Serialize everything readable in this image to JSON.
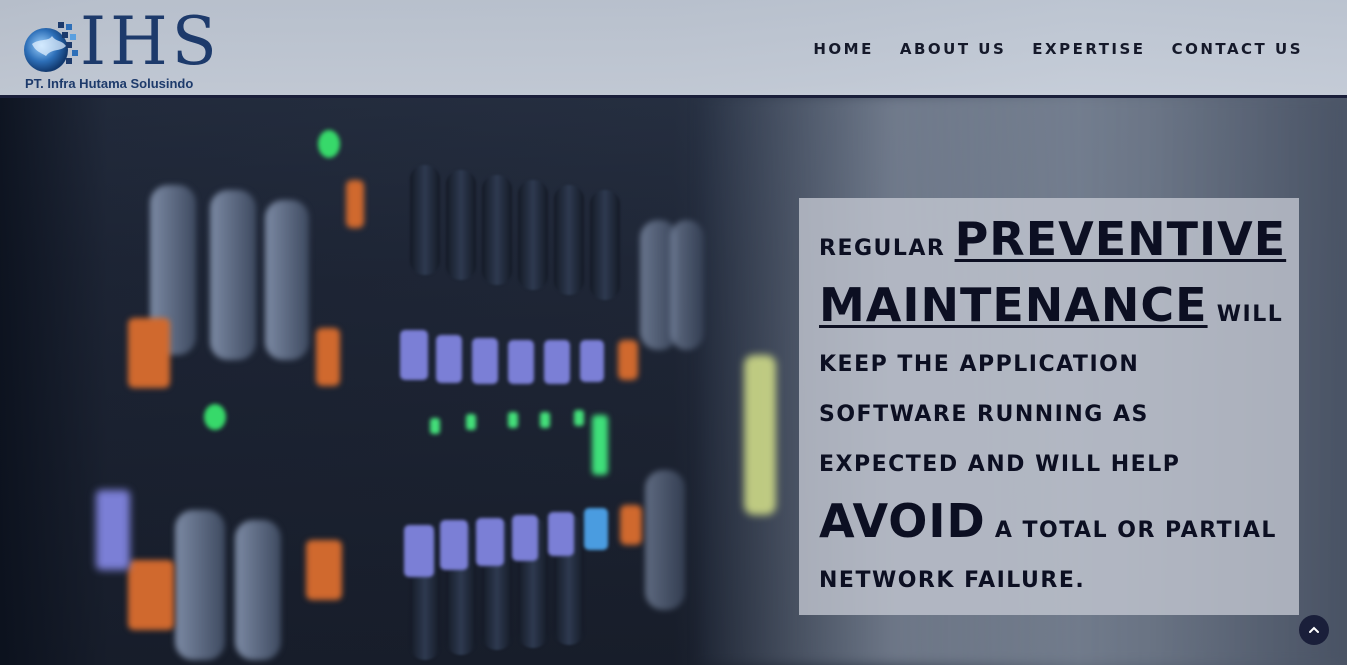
{
  "header": {
    "logo_letters": "IHS",
    "logo_tagline": "PT. Infra Hutama Solusindo",
    "logo_icon": "globe-icon"
  },
  "nav": {
    "items": [
      {
        "label": "HOME"
      },
      {
        "label": "ABOUT US"
      },
      {
        "label": "EXPERTISE"
      },
      {
        "label": "CONTACT US"
      }
    ]
  },
  "hero": {
    "line1_prefix": "REGULAR",
    "line1_emphasis": "PREVENTIVE",
    "line2_emphasis": "MAINTENANCE",
    "line2_suffix": "WILL",
    "line3": "KEEP THE APPLICATION",
    "line4": "SOFTWARE RUNNING AS",
    "line5": "EXPECTED AND WILL HELP",
    "line6_emphasis": "AVOID",
    "line6_suffix": "A TOTAL OR PARTIAL",
    "line7": "NETWORK FAILURE."
  },
  "scroll_top": {
    "icon": "chevron-up-icon"
  },
  "colors": {
    "brand": "#1d3a6b",
    "text_dark": "#0c0f22",
    "header_border": "#1a1f3a"
  }
}
